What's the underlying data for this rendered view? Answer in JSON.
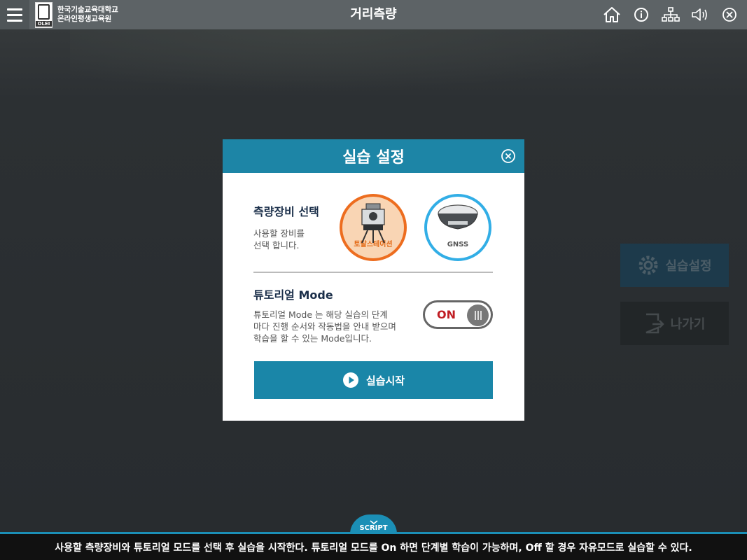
{
  "header": {
    "logo_mark": "OLEI",
    "logo_line1": "한국기술교육대학교",
    "logo_line2": "온라인평생교육원",
    "title": "거리측량",
    "icons": [
      "home-icon",
      "info-icon",
      "sitemap-icon",
      "sound-icon",
      "close-icon"
    ]
  },
  "side_buttons": {
    "settings_label": "실습설정",
    "exit_label": "나가기"
  },
  "modal": {
    "title": "실습 설정",
    "equipment": {
      "title": "측량장비 선택",
      "desc_line1": "사용할 장비를",
      "desc_line2": "선택 합니다.",
      "options": [
        {
          "label": "토탈스테이션",
          "selected": true,
          "color": "#ed6d1f"
        },
        {
          "label": "GNSS",
          "selected": false,
          "color": "#32aee6"
        }
      ]
    },
    "tutorial": {
      "title": "튜토리얼 Mode",
      "desc_line1": "튜토리얼 Mode 는 해당 실습의 단계",
      "desc_line2": "마다 진행 순서와 작동법을 안내 받으며",
      "desc_line3": "학습을 할 수 있는 Mode입니다.",
      "toggle_label": "ON"
    },
    "start_label": "실습시작"
  },
  "script": {
    "tab_label": "SCRIPT",
    "text": "사용할 측량장비와 튜토리얼 모드를 선택 후 실습을 시작한다. 튜토리얼 모드를 On 하면 단계별 학습이 가능하며, Off 할 경우 자유모드로 실습할 수 있다."
  },
  "colors": {
    "accent": "#1d85a6",
    "selected": "#ed6d1f",
    "toggle_on": "#c01e24"
  }
}
